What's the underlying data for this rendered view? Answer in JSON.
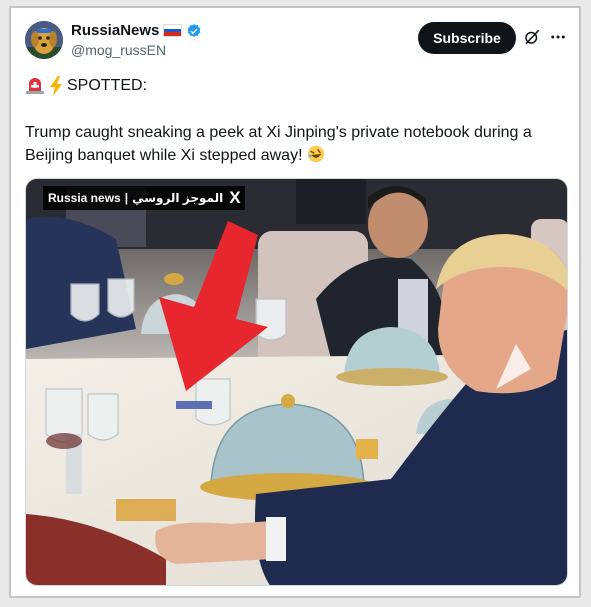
{
  "post": {
    "author": {
      "display_name": "RussiaNews",
      "flag": "russia-flag",
      "verified": true,
      "handle": "@mog_russEN",
      "avatar": "avatar-golden-retriever"
    },
    "subscribe_label": "Subscribe",
    "header_line": "SPOTTED:",
    "header_emojis": [
      "siren-icon",
      "lightning-icon"
    ],
    "text": "Trump caught sneaking a peek at Xi Jinping's private notebook during a Beijing banquet while Xi stepped away!",
    "text_emoji": "rolling-laughing-icon",
    "media": {
      "type": "video-still",
      "watermark_left": "Russia news",
      "watermark_sep": "|",
      "watermark_right": "الموجز الروسي",
      "watermark_logo": "X",
      "overlay": "red-arrow-icon"
    }
  },
  "colors": {
    "subscribe_bg": "#0f1419",
    "verified": "#1d9bf0",
    "handle": "#536471",
    "arrow": "#e8262d"
  }
}
